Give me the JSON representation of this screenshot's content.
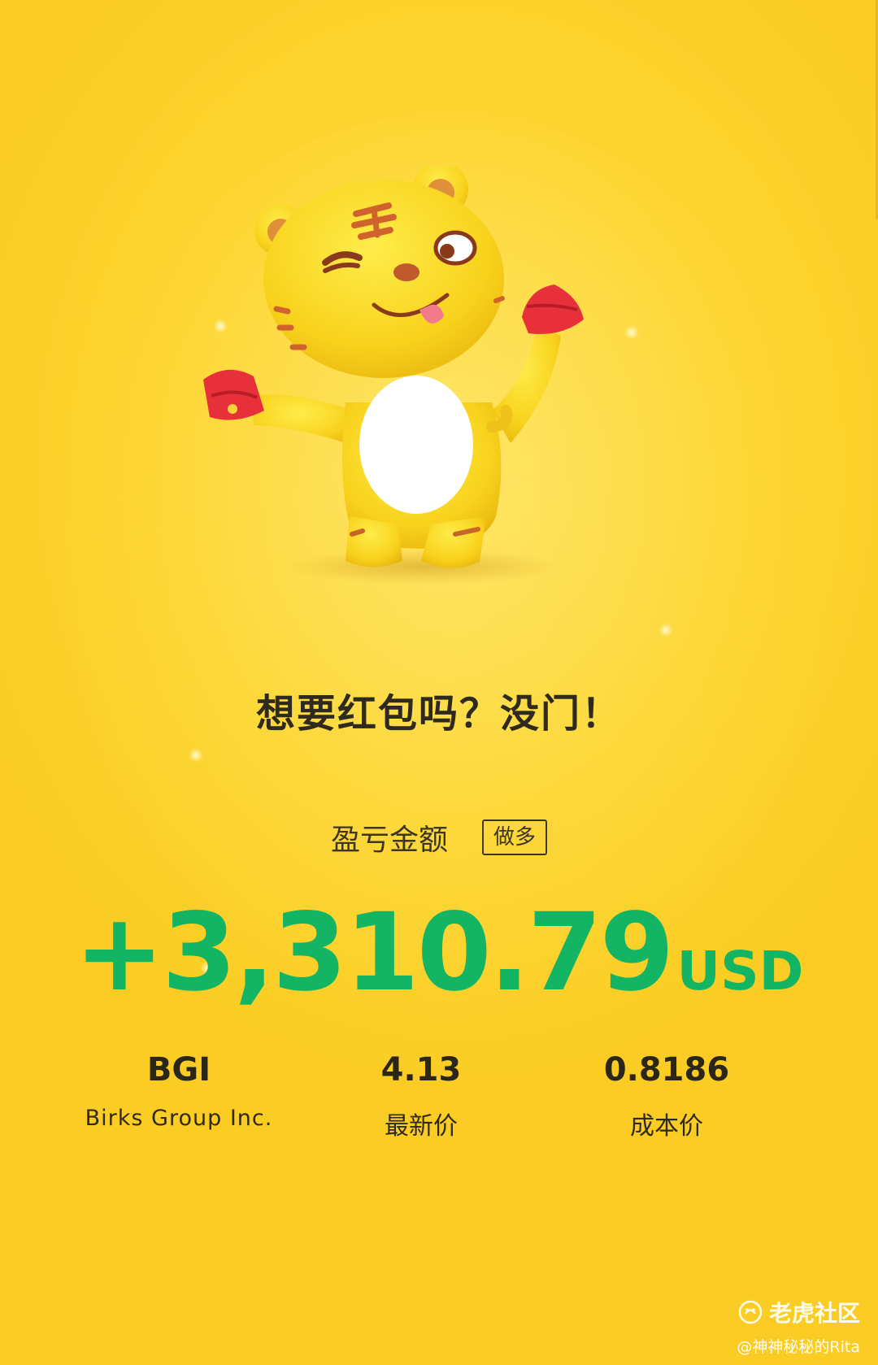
{
  "slogan": "想要红包吗？没门！",
  "pnl": {
    "label": "盈亏金额",
    "direction": "做多",
    "amount": "+3,310.79",
    "currency": "USD"
  },
  "stock": {
    "ticker": "BGI",
    "name": "Birks Group Inc.",
    "latest_price": "4.13",
    "latest_price_label": "最新价",
    "cost_price": "0.8186",
    "cost_price_label": "成本价"
  },
  "footer": {
    "brand": "老虎社区",
    "user": "@神神秘秘的Rita"
  },
  "colors": {
    "background": "#fdd530",
    "profit_green": "#13b463",
    "text_dark": "#2e2a1e"
  },
  "icons": {
    "mascot": "tiger-mascot-with-red-envelopes",
    "brand_logo": "tiger-community-logo"
  }
}
